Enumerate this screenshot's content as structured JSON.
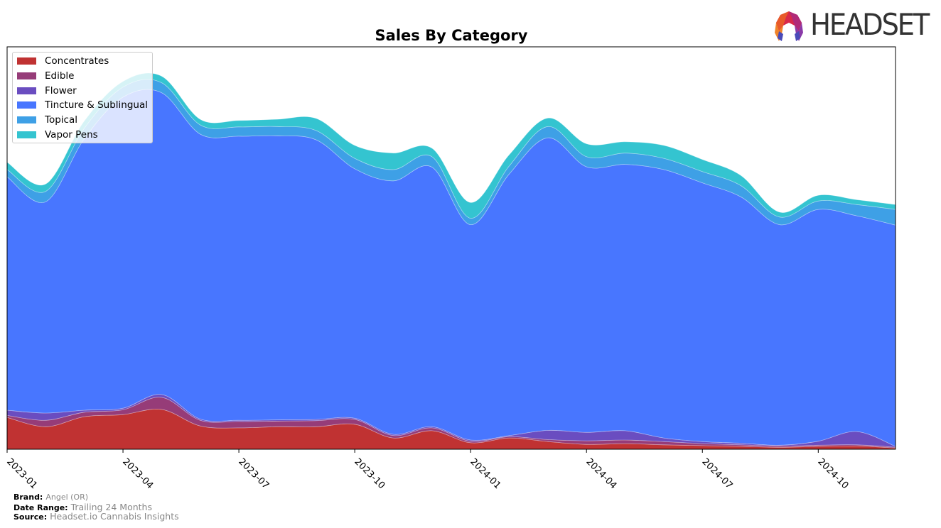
{
  "header": {
    "logo_text": "HEADSET",
    "logo_icon": "headset-logo-icon"
  },
  "footer": {
    "brand_label": "Brand:",
    "brand_value": "Angel (OR)",
    "date_range_label": "Date Range:",
    "date_range_value": "Trailing 24 Months",
    "source_label": "Source:",
    "source_value": "Headset.io Cannabis Insights"
  },
  "chart_data": {
    "type": "area",
    "stacked": true,
    "smoothed": true,
    "title": "Sales By Category",
    "xlabel": "",
    "ylabel": "",
    "y_axis_visible": false,
    "ylim": [
      0,
      100
    ],
    "grid": false,
    "legend_position": "top-left",
    "x": [
      "2023-01",
      "2023-02",
      "2023-03",
      "2023-04",
      "2023-05",
      "2023-06",
      "2023-07",
      "2023-08",
      "2023-09",
      "2023-10",
      "2023-11",
      "2023-12",
      "2024-01",
      "2024-02",
      "2024-03",
      "2024-04",
      "2024-05",
      "2024-06",
      "2024-07",
      "2024-08",
      "2024-09",
      "2024-10",
      "2024-11",
      "2024-12"
    ],
    "x_tick_labels": [
      "2023-01",
      "2023-04",
      "2023-07",
      "2023-10",
      "2024-01",
      "2024-04",
      "2024-07",
      "2024-10"
    ],
    "series": [
      {
        "name": "Concentrates",
        "color": "#c03232",
        "values": [
          7.9,
          5.6,
          8.1,
          8.6,
          9.9,
          5.8,
          5.3,
          5.6,
          5.6,
          6.2,
          2.8,
          4.6,
          1.6,
          2.8,
          1.9,
          1.2,
          1.4,
          1.1,
          0.9,
          0.7,
          0.5,
          0.7,
          0.8,
          0.3
        ]
      },
      {
        "name": "Edible",
        "color": "#963c78",
        "values": [
          0.5,
          1.6,
          1.1,
          1.2,
          3.0,
          1.4,
          1.6,
          1.4,
          1.5,
          1.2,
          0.6,
          0.7,
          0.4,
          0.3,
          0.5,
          0.9,
          0.9,
          0.8,
          0.5,
          0.4,
          0.3,
          0.3,
          0.3,
          0.2
        ]
      },
      {
        "name": "Flower",
        "color": "#6a4dc0",
        "values": [
          1.3,
          1.8,
          0.5,
          0.4,
          0.7,
          0.3,
          0.3,
          0.3,
          0.3,
          0.3,
          0.3,
          0.3,
          0.3,
          0.3,
          2.3,
          2.1,
          2.3,
          0.9,
          0.5,
          0.4,
          0.2,
          1.0,
          3.3,
          0.2
        ]
      },
      {
        "name": "Tincture & Sublingual",
        "color": "#4876ff",
        "values": [
          58.0,
          52.5,
          67.5,
          77.3,
          75.0,
          70.8,
          70.6,
          70.6,
          69.5,
          62.0,
          63.0,
          64.5,
          53.5,
          65.0,
          72.7,
          66.0,
          66.2,
          66.7,
          64.3,
          61.2,
          54.8,
          57.6,
          53.6,
          55.0
        ]
      },
      {
        "name": "Topical",
        "color": "#3ea0e6",
        "values": [
          1.8,
          2.6,
          2.6,
          2.5,
          2.5,
          2.3,
          2.3,
          2.3,
          2.3,
          2.6,
          2.8,
          2.6,
          1.6,
          2.0,
          2.8,
          2.5,
          2.8,
          2.8,
          2.8,
          2.8,
          1.9,
          2.1,
          2.8,
          3.9
        ]
      },
      {
        "name": "Vapor Pens",
        "color": "#34c4d0",
        "values": [
          1.8,
          1.8,
          1.8,
          1.4,
          1.6,
          1.4,
          1.6,
          1.8,
          3.0,
          3.2,
          4.1,
          2.1,
          3.9,
          2.8,
          2.1,
          3.2,
          2.8,
          3.2,
          3.0,
          2.5,
          1.2,
          1.4,
          1.2,
          1.2
        ]
      }
    ]
  }
}
